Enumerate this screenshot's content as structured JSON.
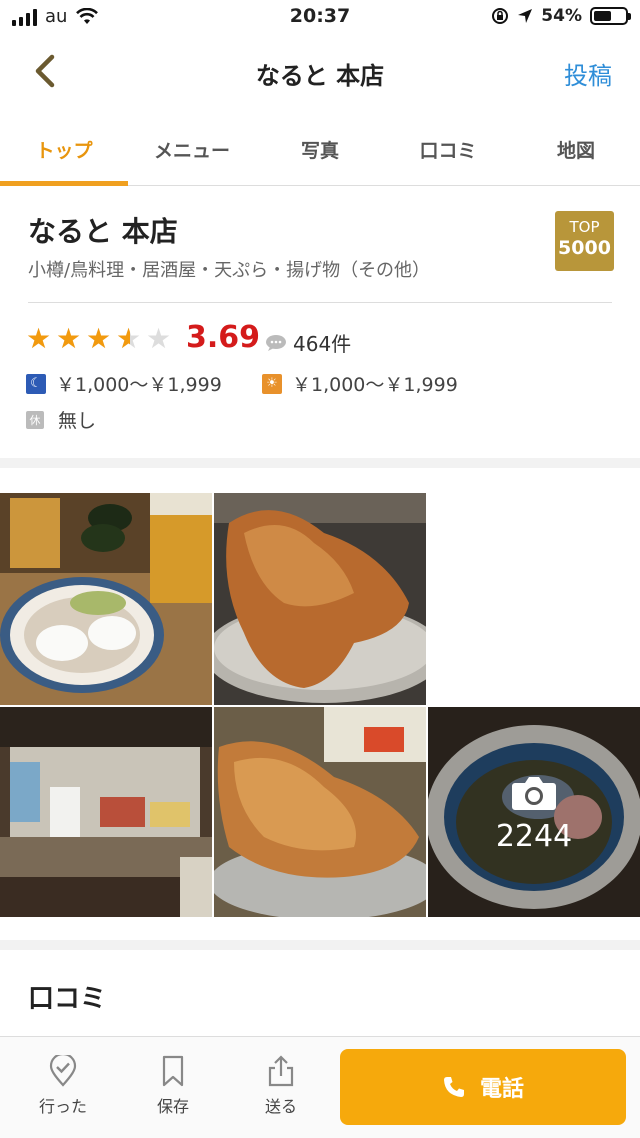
{
  "status_bar": {
    "carrier": "au",
    "time": "20:37",
    "battery": "54%"
  },
  "nav": {
    "title": "なると 本店",
    "post_label": "投稿"
  },
  "tabs": [
    {
      "label": "トップ",
      "active": true
    },
    {
      "label": "メニュー",
      "active": false
    },
    {
      "label": "写真",
      "active": false
    },
    {
      "label": "口コミ",
      "active": false
    },
    {
      "label": "地図",
      "active": false
    }
  ],
  "restaurant": {
    "name": "なると 本店",
    "genre": "小樽/鳥料理・居酒屋・天ぷら・揚げ物（その他）",
    "badge_line1": "TOP",
    "badge_line2": "5000",
    "rating": 3.69,
    "rating_label": "3.69",
    "review_count": "464件",
    "dinner_price": "￥1,000～￥1,999",
    "lunch_price": "￥1,000～￥1,999",
    "holiday_icon": "休",
    "holiday": "無し"
  },
  "photos": {
    "count": "2244"
  },
  "reviews_section": {
    "title": "口コミ"
  },
  "bottom_bar": {
    "went_label": "行った",
    "save_label": "保存",
    "share_label": "送る",
    "call_label": "電話"
  },
  "colors": {
    "accent": "#f0a020",
    "link": "#2f8ed8",
    "score": "#d41b1b",
    "badge": "#b8963a",
    "call_button": "#f6a90c"
  }
}
